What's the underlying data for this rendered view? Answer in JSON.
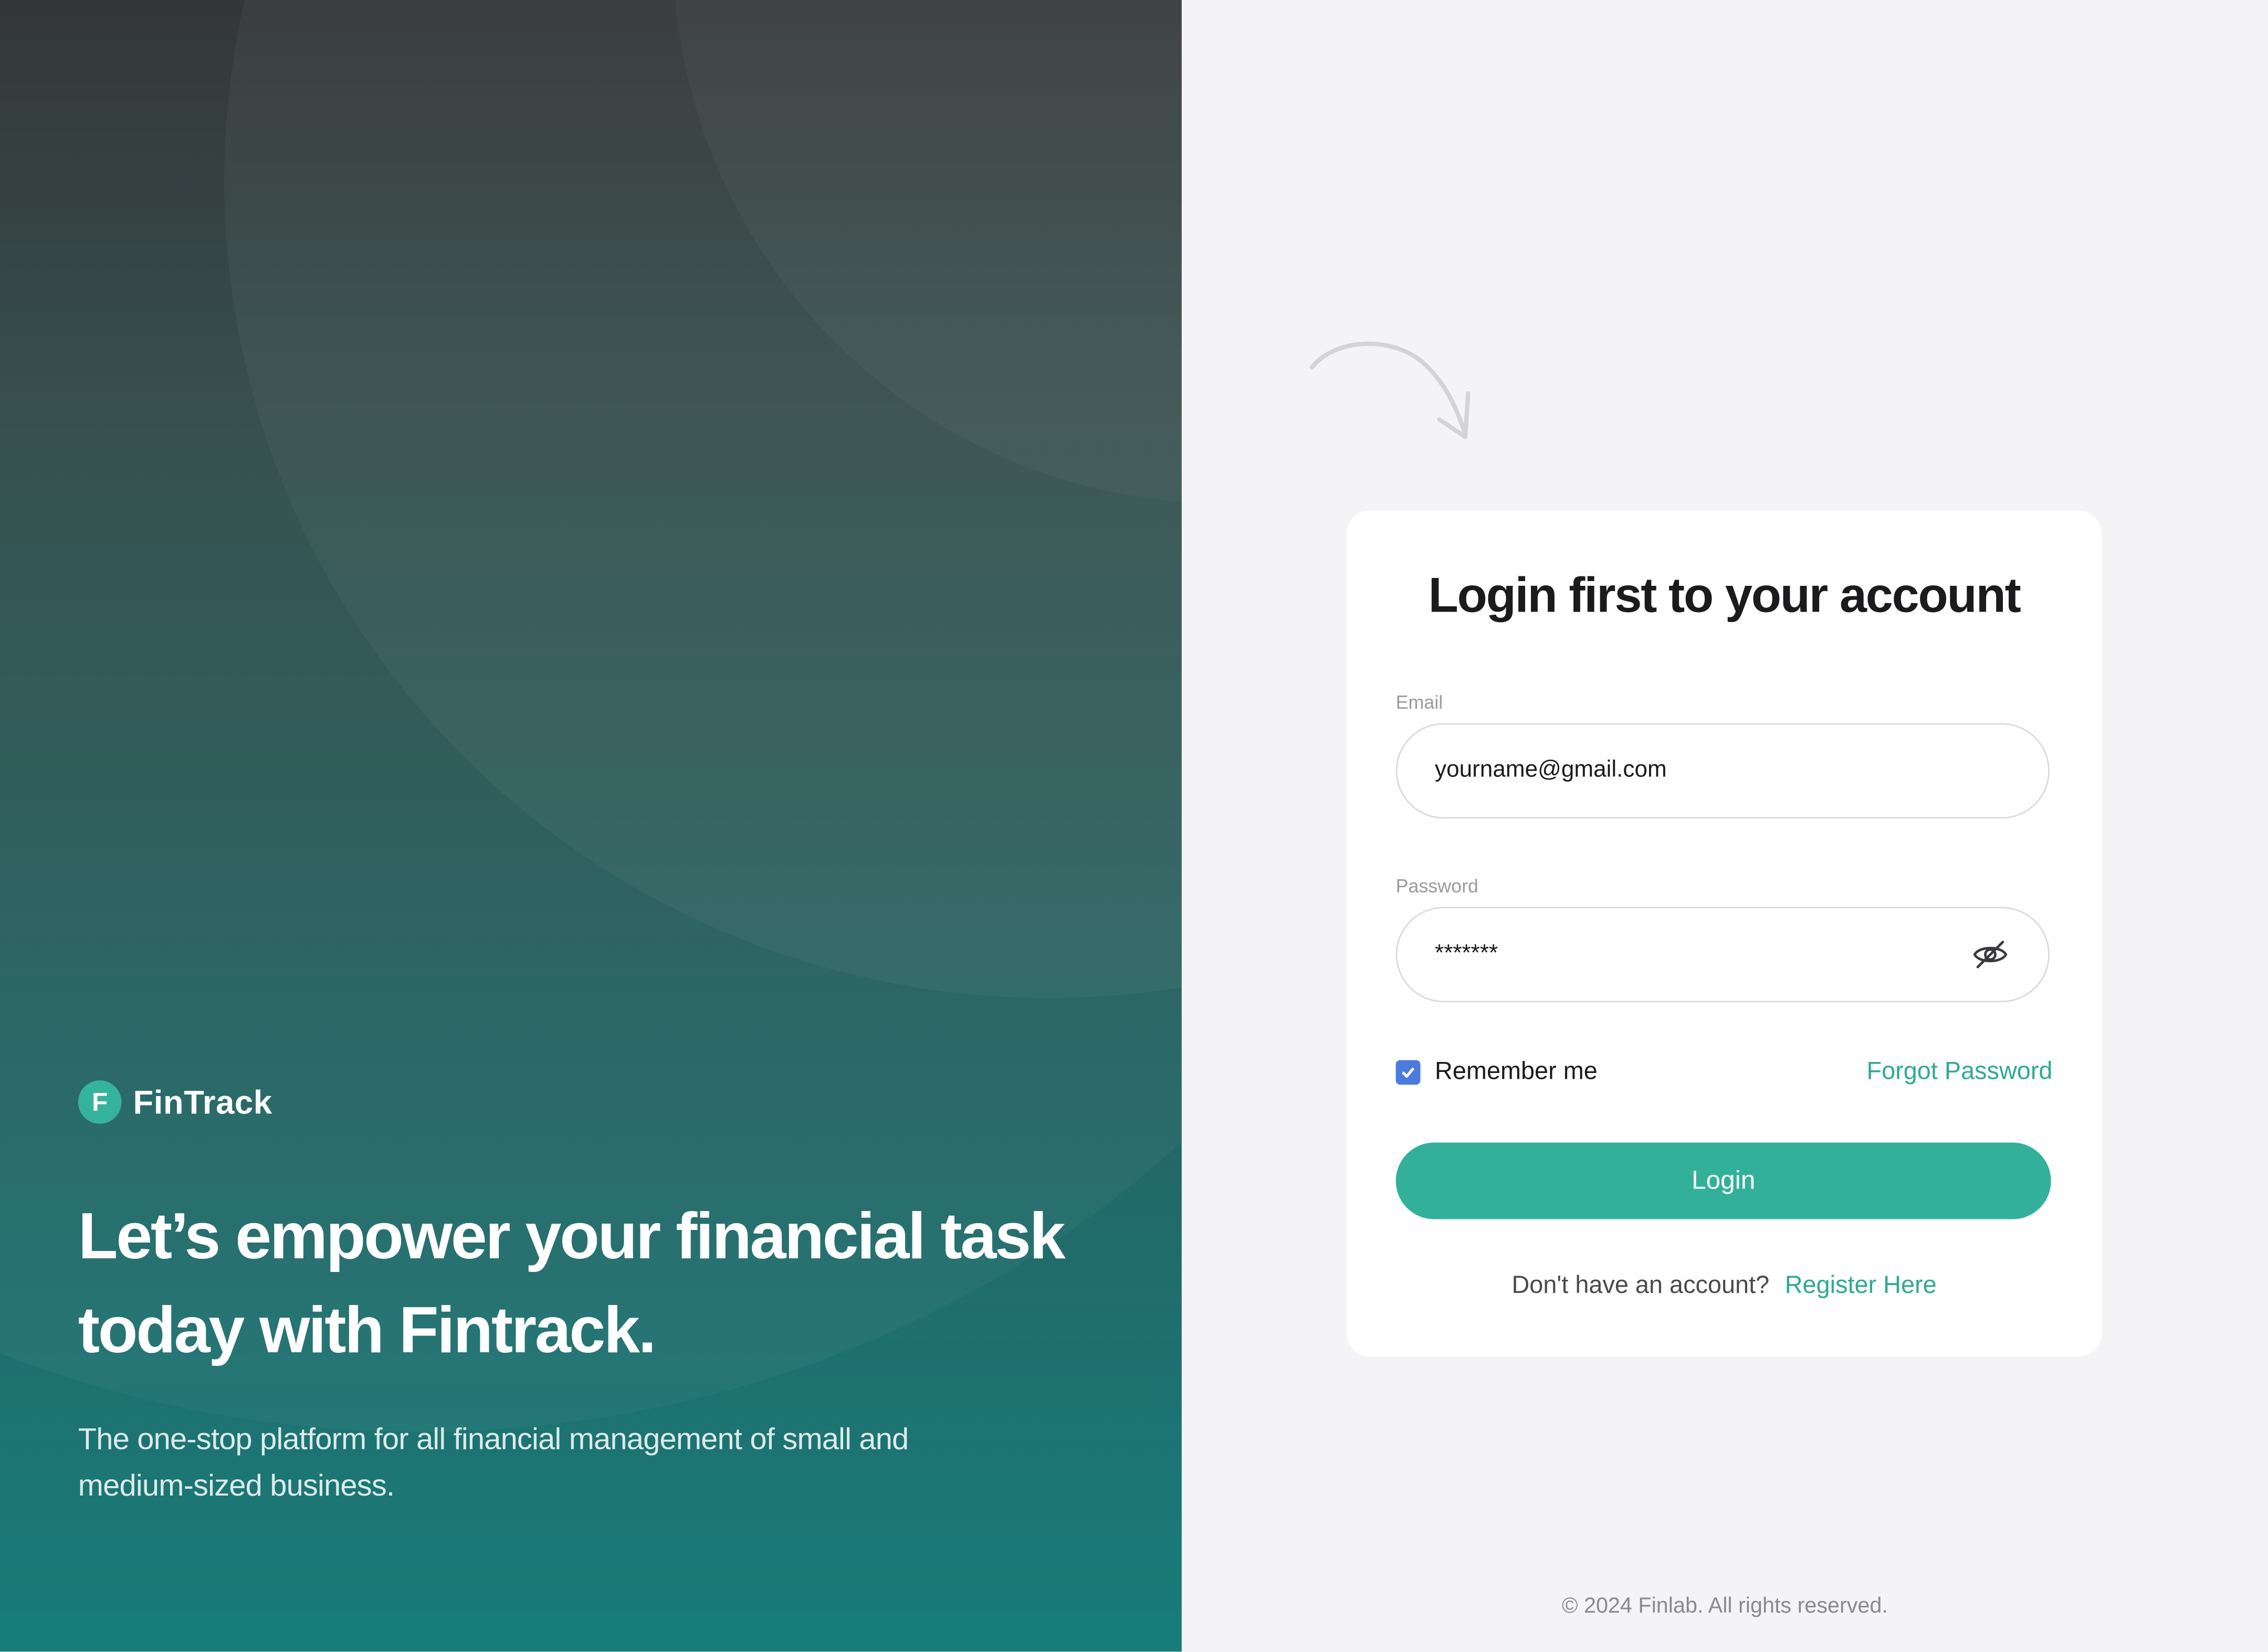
{
  "brand": {
    "mark_letter": "F",
    "name": "FinTrack"
  },
  "hero": {
    "headline": "Let’s empower your financial task today with Fintrack.",
    "subheadline": "The one-stop platform for all financial management of small and medium-sized business."
  },
  "login_card": {
    "title": "Login first to your account",
    "email": {
      "label": "Email",
      "value": "yourname@gmail.com"
    },
    "password": {
      "label": "Password",
      "value": "*******",
      "toggle_icon": "eye-off-icon"
    },
    "remember_me": {
      "label": "Remember me",
      "checked": true
    },
    "forgot_password": "Forgot Password",
    "login_button": "Login",
    "register": {
      "prompt": "Don't have an account?",
      "link": "Register Here"
    }
  },
  "footer": {
    "copyright": "© 2024 Finlab. All rights reserved."
  },
  "colors": {
    "accent": "#33b09a",
    "link": "#2eaa91",
    "checkbox": "#4b7bdc",
    "hero_top": "#2d2f31",
    "hero_bottom": "#187d79",
    "background": "#f4f4f6"
  }
}
